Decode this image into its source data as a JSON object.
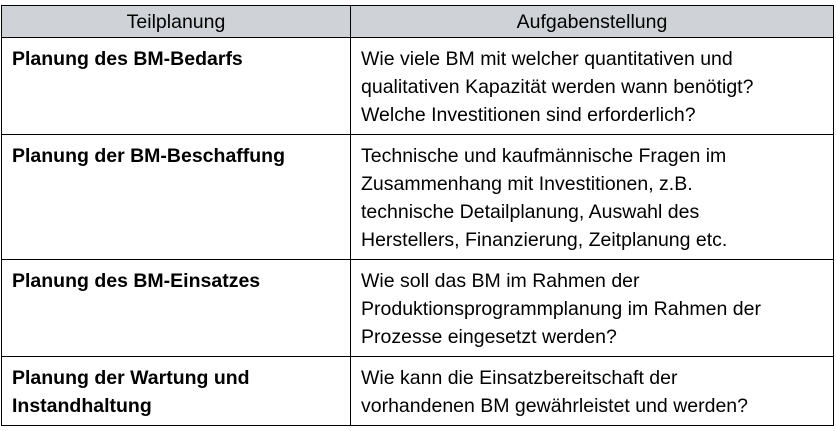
{
  "table": {
    "headers": [
      "Teilplanung",
      "Aufgabenstellung"
    ],
    "rows": [
      {
        "label": "Planung des BM-Bedarfs",
        "lines": [
          "Wie viele BM mit welcher quantitativen und",
          "qualitativen Kapazität werden wann benötigt?",
          "Welche Investitionen sind erforderlich?"
        ]
      },
      {
        "label": "Planung der BM-Beschaffung",
        "lines": [
          "Technische und kaufmännische Fragen im",
          "Zusammenhang mit Investitionen, z.B.",
          "technische Detailplanung, Auswahl des",
          "Herstellers, Finanzierung, Zeitplanung etc."
        ]
      },
      {
        "label": "Planung des BM-Einsatzes",
        "lines": [
          "Wie soll das BM im Rahmen der",
          "Produktionsprogrammplanung im Rahmen der",
          "Prozesse eingesetzt werden?"
        ]
      },
      {
        "label_lines": [
          "Planung der Wartung und",
          "Instandhaltung"
        ],
        "lines": [
          "Wie kann die Einsatzbereitschaft der",
          "vorhandenen BM gewährleistet und werden?"
        ]
      }
    ]
  }
}
